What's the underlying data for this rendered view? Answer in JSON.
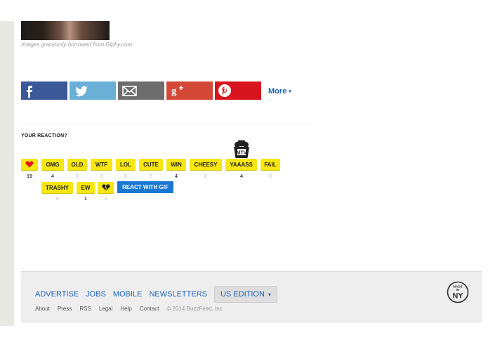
{
  "media": {
    "credit": "Images graciously borrowed from Giphy.com"
  },
  "share": {
    "buttons": [
      {
        "network": "facebook",
        "icon": "facebook-icon",
        "color": "#3b5998"
      },
      {
        "network": "twitter",
        "icon": "twitter-icon",
        "color": "#6aafd6"
      },
      {
        "network": "email",
        "icon": "email-icon",
        "color": "#6d6d6d"
      },
      {
        "network": "google-plus",
        "icon": "google-plus-icon",
        "color": "#d34836"
      },
      {
        "network": "pinterest",
        "icon": "pinterest-icon",
        "color": "#d8141f"
      }
    ],
    "more_label": "More",
    "more_caret": "▾"
  },
  "reactions": {
    "title": "YOUR REACTION?",
    "row1": [
      {
        "label": "",
        "icon": "heart-icon",
        "count": "19"
      },
      {
        "label": "OMG",
        "count": "4"
      },
      {
        "label": "OLD",
        "count": "0"
      },
      {
        "label": "WTF",
        "count": "0"
      },
      {
        "label": "LOL",
        "count": "0"
      },
      {
        "label": "CUTE",
        "count": "0"
      },
      {
        "label": "WIN",
        "count": "4"
      },
      {
        "label": "CHEESY",
        "count": "0"
      },
      {
        "label": "YAAASS",
        "count": "4",
        "badge": "MTV"
      },
      {
        "label": "FAIL",
        "count": "0"
      }
    ],
    "row2": [
      {
        "label": "TRASHY",
        "count": "0"
      },
      {
        "label": "EW",
        "count": "1"
      },
      {
        "label": "",
        "icon": "broken-heart-icon",
        "count": "0"
      }
    ],
    "gif_label": "REACT WITH GIF"
  },
  "footer": {
    "nav": [
      "ADVERTISE",
      "JOBS",
      "MOBILE",
      "NEWSLETTERS"
    ],
    "edition_label": "US EDITION",
    "edition_caret": "▾",
    "links": [
      "About",
      "Press",
      "RSS",
      "Legal",
      "Help",
      "Contact"
    ],
    "copyright": "© 2014 BuzzFeed, Inc",
    "badge": {
      "line1": "MADE",
      "line2": "IN",
      "line3": "NY"
    }
  },
  "colors": {
    "reaction_yellow": "#f6e612",
    "link_blue": "#1d62b5",
    "gif_blue": "#1b78d1",
    "heart_red": "#e0191f"
  }
}
